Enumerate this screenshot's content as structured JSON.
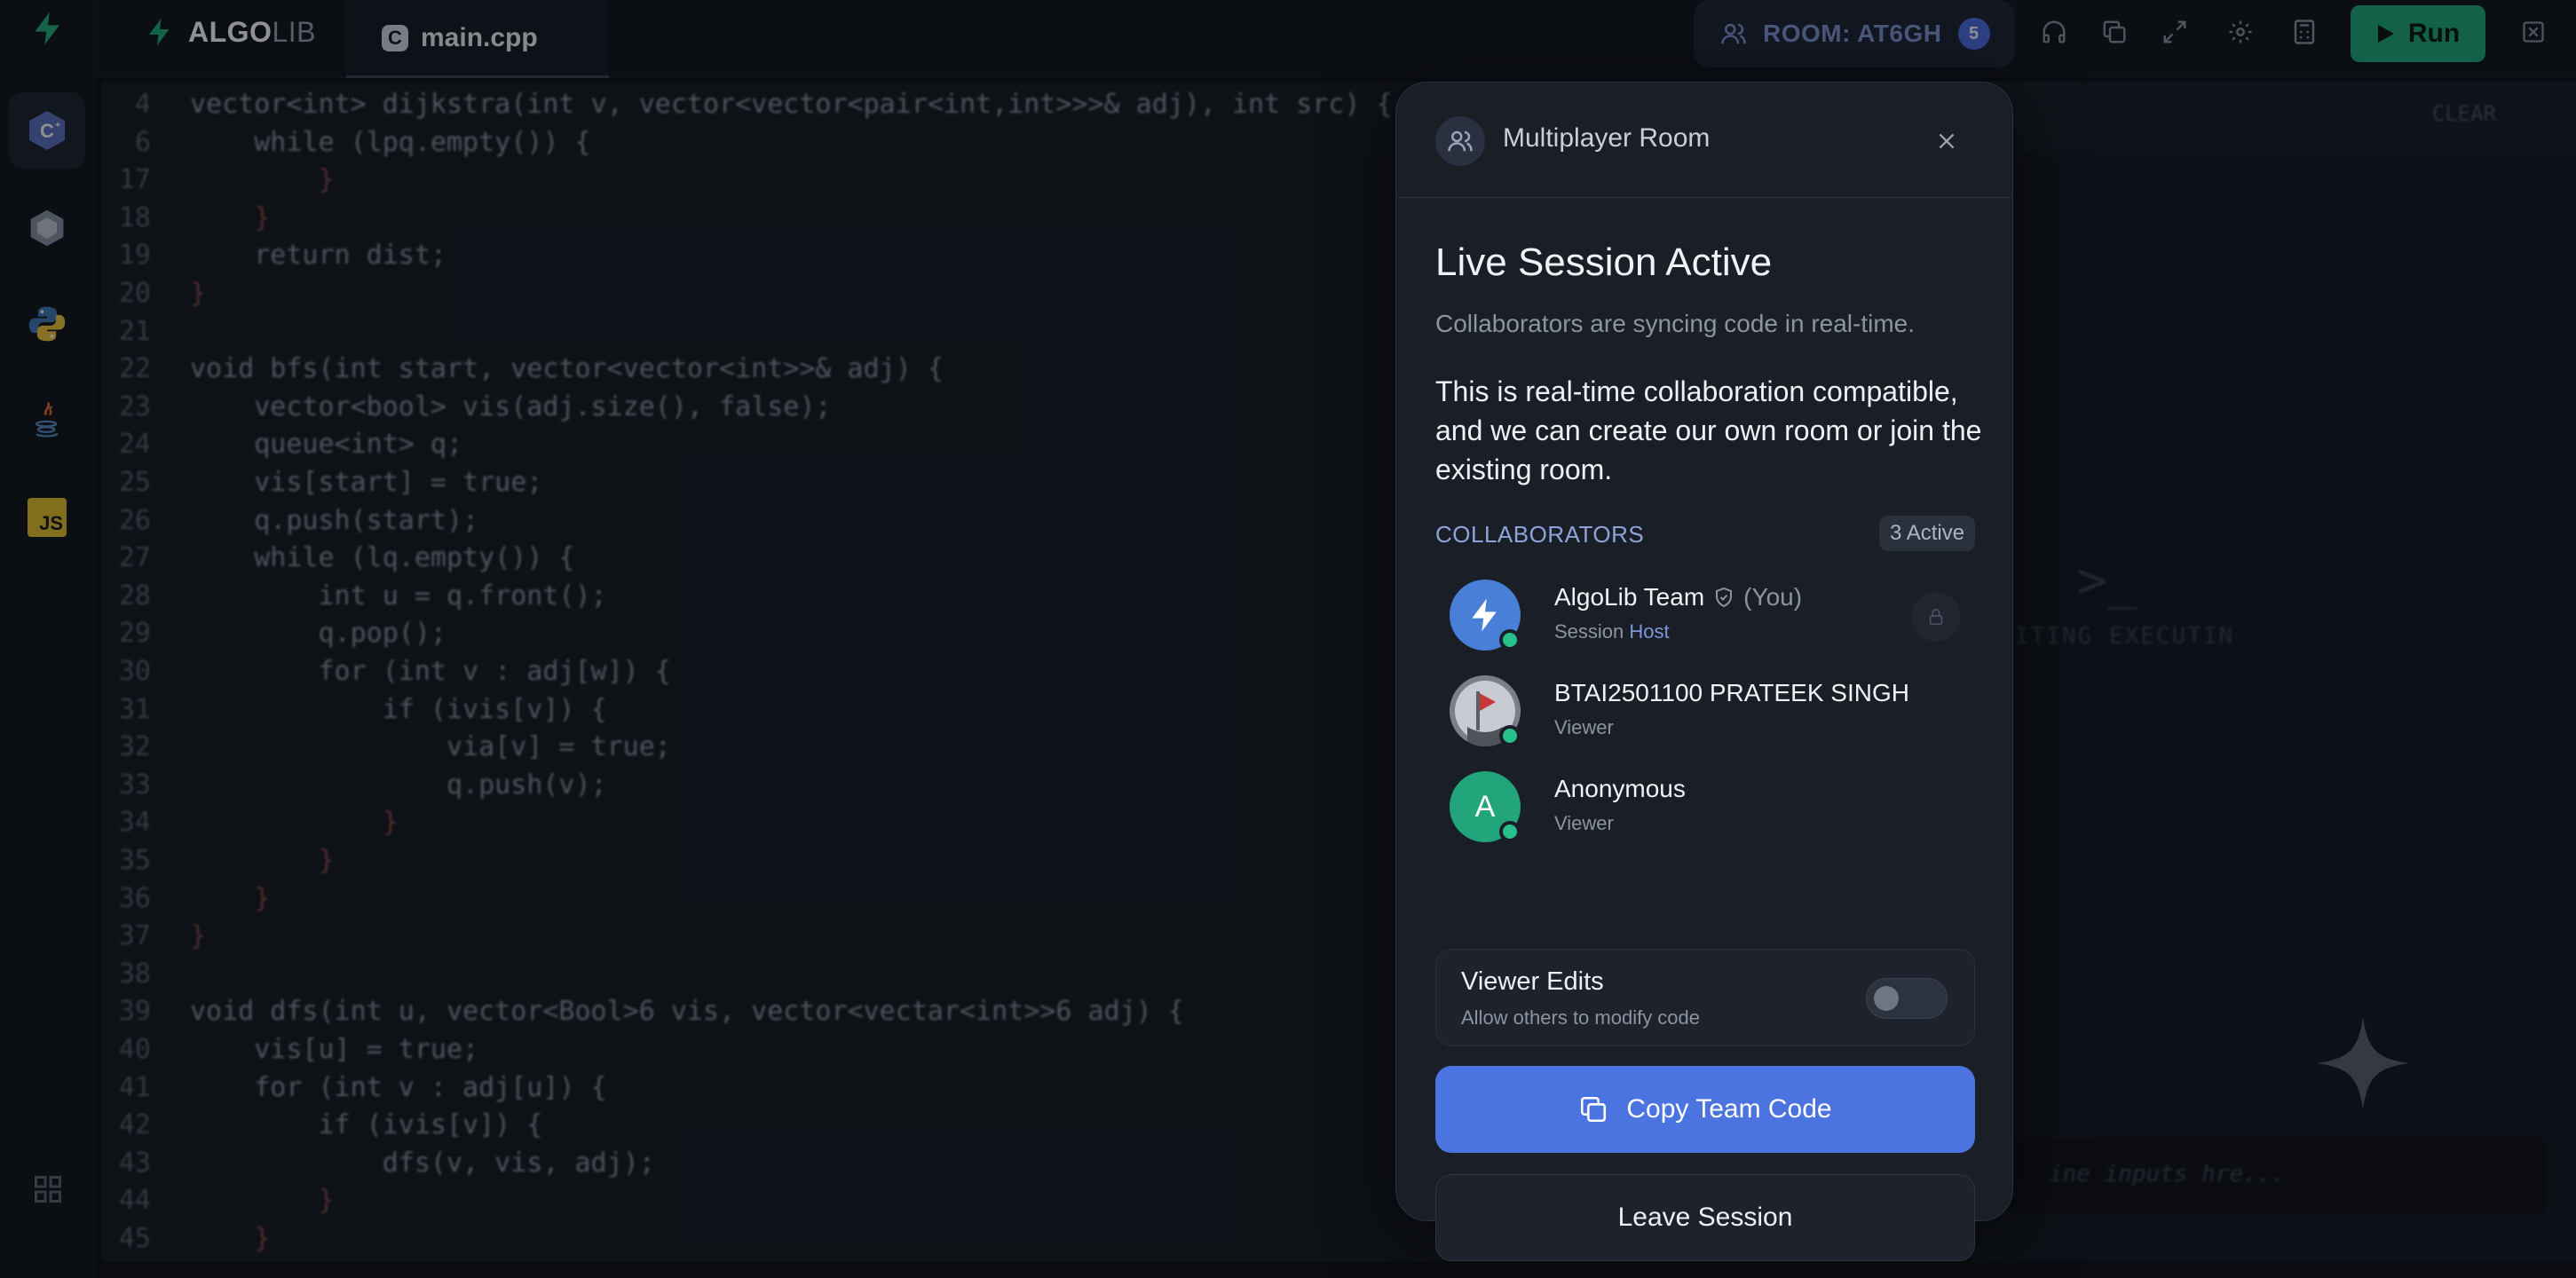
{
  "brand": {
    "bold": "ALGO",
    "light": "LIB"
  },
  "file_tab": {
    "icon_letter": "C",
    "name": "main.cpp"
  },
  "rail": {
    "items": [
      {
        "name": "cpp",
        "label": "C"
      },
      {
        "name": "c",
        "label": "C"
      },
      {
        "name": "python",
        "label": ""
      },
      {
        "name": "java",
        "label": ""
      },
      {
        "name": "javascript",
        "label": "JS"
      }
    ]
  },
  "room": {
    "label": "ROOM: AT6GH",
    "count": "5"
  },
  "run": {
    "label": "Run"
  },
  "right_panel": {
    "clear": "CLEAR",
    "prompt": ">_",
    "waiting": "ITING EXECUTIN",
    "input_placeholder": "ine inputs hre..."
  },
  "code": [
    {
      "n": "4",
      "t": "vector<int> dijkstra(int v, vector<vector<pair<int,int>>>& adj), int src) {"
    },
    {
      "n": "6",
      "t": "    while (lpq.empty()) {"
    },
    {
      "n": "17",
      "t": "        }"
    },
    {
      "n": "18",
      "t": "    }"
    },
    {
      "n": "19",
      "t": "    return dist;"
    },
    {
      "n": "20",
      "t": "}"
    },
    {
      "n": "21",
      "t": ""
    },
    {
      "n": "22",
      "t": "void bfs(int start, vector<vector<int>>& adj) {"
    },
    {
      "n": "23",
      "t": "    vector<bool> vis(adj.size(), false);"
    },
    {
      "n": "24",
      "t": "    queue<int> q;"
    },
    {
      "n": "25",
      "t": "    vis[start] = true;"
    },
    {
      "n": "26",
      "t": "    q.push(start);"
    },
    {
      "n": "27",
      "t": "    while (lq.empty()) {"
    },
    {
      "n": "28",
      "t": "        int u = q.front();"
    },
    {
      "n": "29",
      "t": "        q.pop();"
    },
    {
      "n": "30",
      "t": "        for (int v : adj[w]) {"
    },
    {
      "n": "31",
      "t": "            if (ivis[v]) {"
    },
    {
      "n": "32",
      "t": "                via[v] = true;"
    },
    {
      "n": "33",
      "t": "                q.push(v);"
    },
    {
      "n": "34",
      "t": "            }"
    },
    {
      "n": "35",
      "t": "        }"
    },
    {
      "n": "36",
      "t": "    }"
    },
    {
      "n": "37",
      "t": "}"
    },
    {
      "n": "38",
      "t": ""
    },
    {
      "n": "39",
      "t": "void dfs(int u, vector<Bool>6 vis, vector<vectar<int>>6 adj) {"
    },
    {
      "n": "40",
      "t": "    vis[u] = true;"
    },
    {
      "n": "41",
      "t": "    for (int v : adj[u]) {"
    },
    {
      "n": "42",
      "t": "        if (ivis[v]) {"
    },
    {
      "n": "43",
      "t": "            dfs(v, vis, adj);"
    },
    {
      "n": "44",
      "t": "        }"
    },
    {
      "n": "45",
      "t": "    }"
    }
  ],
  "modal": {
    "title": "Multiplayer Room",
    "live_title": "Live Session Active",
    "live_subtitle": "Collaborators are syncing code in real-time.",
    "description": "This is real-time collaboration compatible, and we can create our own room or join the existing room.",
    "collaborators_label": "COLLABORATORS",
    "active_count": "3 Active",
    "members": [
      {
        "name": "AlgoLib Team",
        "you": "(You)",
        "role_prefix": "Session ",
        "role_highlight": "Host",
        "avatar": "bolt",
        "color": "#4a7fd8"
      },
      {
        "name": "BTAI2501100 PRATEEK SINGH",
        "you": "",
        "role_prefix": "Viewer",
        "role_highlight": "",
        "avatar": "photo",
        "color": "#6b7280"
      },
      {
        "name": "Anonymous",
        "you": "",
        "role_prefix": "Viewer",
        "role_highlight": "",
        "avatar": "A",
        "color": "#22a57a"
      }
    ],
    "viewer_edits": {
      "title": "Viewer Edits",
      "subtitle": "Allow others to modify code",
      "enabled": false
    },
    "copy_button": "Copy Team Code",
    "leave_button": "Leave Session"
  }
}
